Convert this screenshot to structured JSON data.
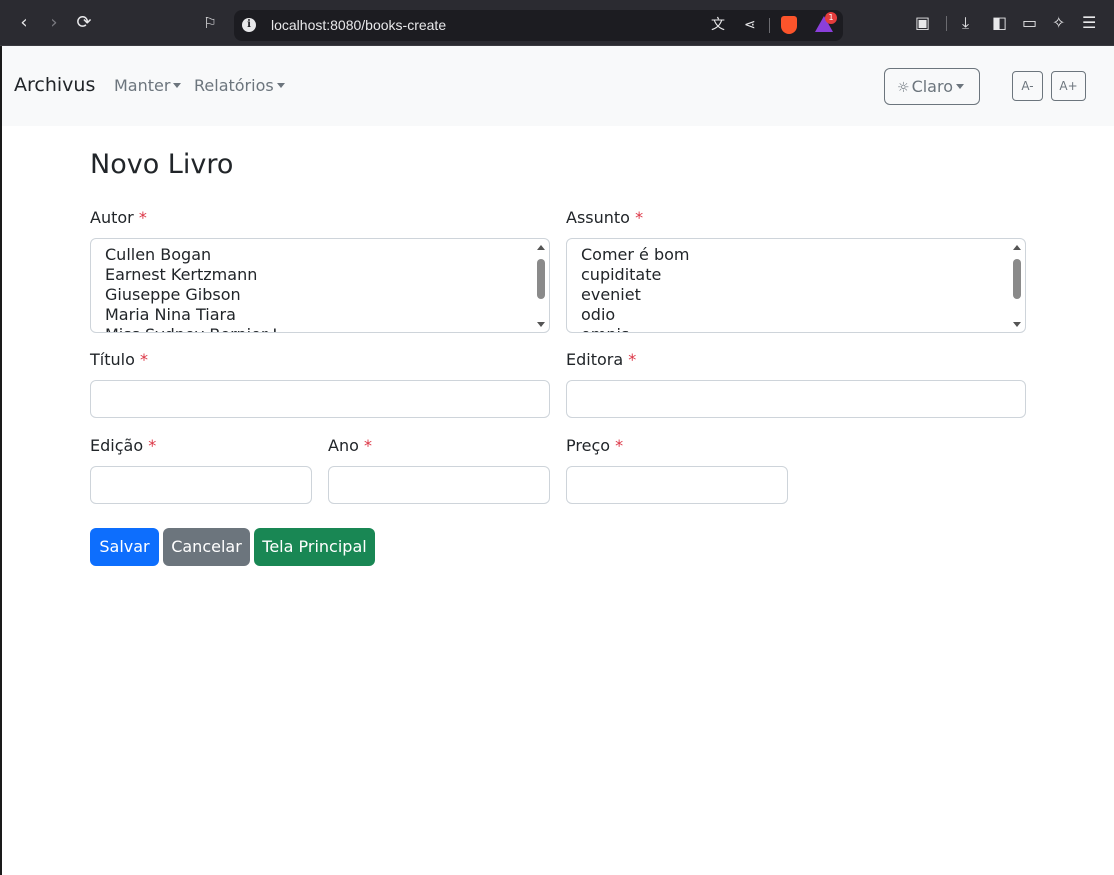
{
  "browser": {
    "url": "localhost:8080/books-create",
    "back_icon": "back-arrow",
    "forward_icon": "forward-arrow",
    "reload_icon": "reload",
    "bookmark_icon": "bookmark",
    "notification_count": "1"
  },
  "navbar": {
    "brand": "Archivus",
    "menus": [
      {
        "label": "Manter"
      },
      {
        "label": "Relatórios"
      }
    ],
    "theme_label": "Claro",
    "font_decrease": "A-",
    "font_increase": "A+"
  },
  "form": {
    "title": "Novo Livro",
    "required_mark": "*",
    "autor": {
      "label": "Autor",
      "options": [
        "Cullen Bogan",
        "Earnest Kertzmann",
        "Giuseppe Gibson",
        "Maria Nina Tiara",
        "Miss Sydney Bernier I"
      ]
    },
    "assunto": {
      "label": "Assunto",
      "options": [
        "Comer é bom",
        "cupiditate",
        "eveniet",
        "odio",
        "omnis"
      ]
    },
    "titulo": {
      "label": "Título",
      "value": ""
    },
    "editora": {
      "label": "Editora",
      "value": ""
    },
    "edicao": {
      "label": "Edição",
      "value": ""
    },
    "ano": {
      "label": "Ano",
      "value": ""
    },
    "preco": {
      "label": "Preço",
      "value": ""
    },
    "buttons": {
      "save": "Salvar",
      "cancel": "Cancelar",
      "home": "Tela Principal"
    }
  },
  "colors": {
    "primary": "#0d6efd",
    "secondary": "#6c757d",
    "success": "#198754",
    "required": "#dc3545"
  }
}
